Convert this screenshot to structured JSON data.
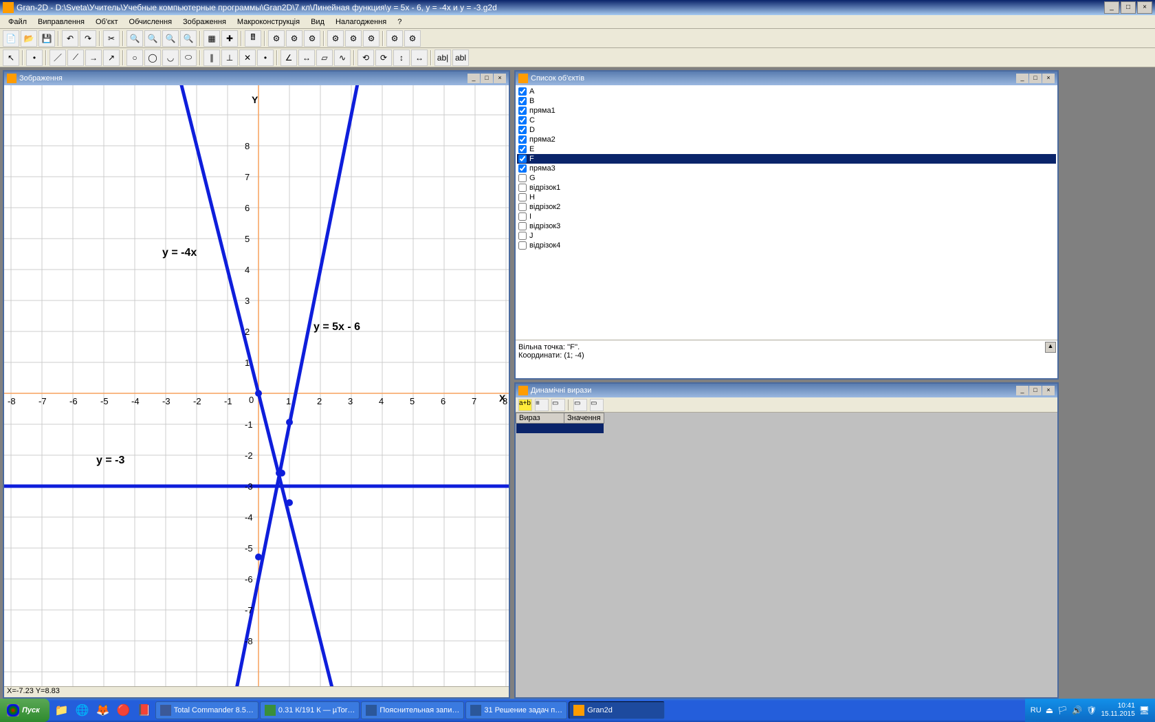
{
  "app": {
    "title": "Gran-2D - D:\\Sveta\\Учитель\\Учебные компьютерные программы\\Gran2D\\7 кл\\Линейная функция\\y = 5x - 6, y = -4x и y = -3.g2d"
  },
  "menu": {
    "file": "Файл",
    "edit": "Виправлення",
    "object": "Об'єкт",
    "calc": "Обчислення",
    "image": "Зображення",
    "macro": "Макроконструкція",
    "view": "Вид",
    "debug": "Налагодження",
    "help": "?"
  },
  "panels": {
    "graph": {
      "title": "Зображення",
      "status": "X=-7.23 Y=8.83"
    },
    "objects": {
      "title": "Список об'єктів",
      "items": [
        {
          "label": "A",
          "checked": true,
          "selected": false
        },
        {
          "label": "B",
          "checked": true,
          "selected": false
        },
        {
          "label": "пряма1",
          "checked": true,
          "selected": false
        },
        {
          "label": "C",
          "checked": true,
          "selected": false
        },
        {
          "label": "D",
          "checked": true,
          "selected": false
        },
        {
          "label": "пряма2",
          "checked": true,
          "selected": false
        },
        {
          "label": "E",
          "checked": true,
          "selected": false
        },
        {
          "label": "F",
          "checked": true,
          "selected": true
        },
        {
          "label": "пряма3",
          "checked": true,
          "selected": false
        },
        {
          "label": "G",
          "checked": false,
          "selected": false
        },
        {
          "label": "відрізок1",
          "checked": false,
          "selected": false
        },
        {
          "label": "H",
          "checked": false,
          "selected": false
        },
        {
          "label": "відрізок2",
          "checked": false,
          "selected": false
        },
        {
          "label": "I",
          "checked": false,
          "selected": false
        },
        {
          "label": "відрізок3",
          "checked": false,
          "selected": false
        },
        {
          "label": "J",
          "checked": false,
          "selected": false
        },
        {
          "label": "відрізок4",
          "checked": false,
          "selected": false
        }
      ],
      "info_line1": "Вільна точка: ''F''.",
      "info_line2": "Координати: (1; -4)"
    },
    "dynamic": {
      "title": "Динамічні вирази",
      "col1": "Вираз",
      "col2": "Значення"
    }
  },
  "chart_data": {
    "type": "line",
    "xlabel": "X",
    "ylabel": "Y",
    "xlim": [
      -8,
      8
    ],
    "ylim": [
      -8,
      9
    ],
    "x_ticks": [
      -8,
      -7,
      -6,
      -5,
      -4,
      -3,
      -2,
      -1,
      0,
      1,
      2,
      3,
      4,
      5,
      6,
      7,
      8
    ],
    "y_ticks": [
      -8,
      -7,
      -6,
      -5,
      -4,
      -3,
      -2,
      -1,
      0,
      1,
      2,
      3,
      4,
      5,
      6,
      7,
      8
    ],
    "series": [
      {
        "name": "y = -4x",
        "type": "linear",
        "slope": -4,
        "intercept": 0
      },
      {
        "name": "y = 5x - 6",
        "type": "linear",
        "slope": 5,
        "intercept": -6
      },
      {
        "name": "y = -3",
        "type": "constant",
        "value": -3
      }
    ],
    "labels": {
      "l1": "y = -4x",
      "l2": "y = 5x - 6",
      "l3": "y = -3"
    }
  },
  "taskbar": {
    "start": "Пуск",
    "items": [
      "Total Commander 8.5…",
      "0.31 К/191 К — µTor…",
      "Пояснительная запи…",
      "31 Решение задач п…",
      "Gran2d"
    ],
    "lang": "RU",
    "time": "10:41",
    "date": "15.11.2015"
  }
}
